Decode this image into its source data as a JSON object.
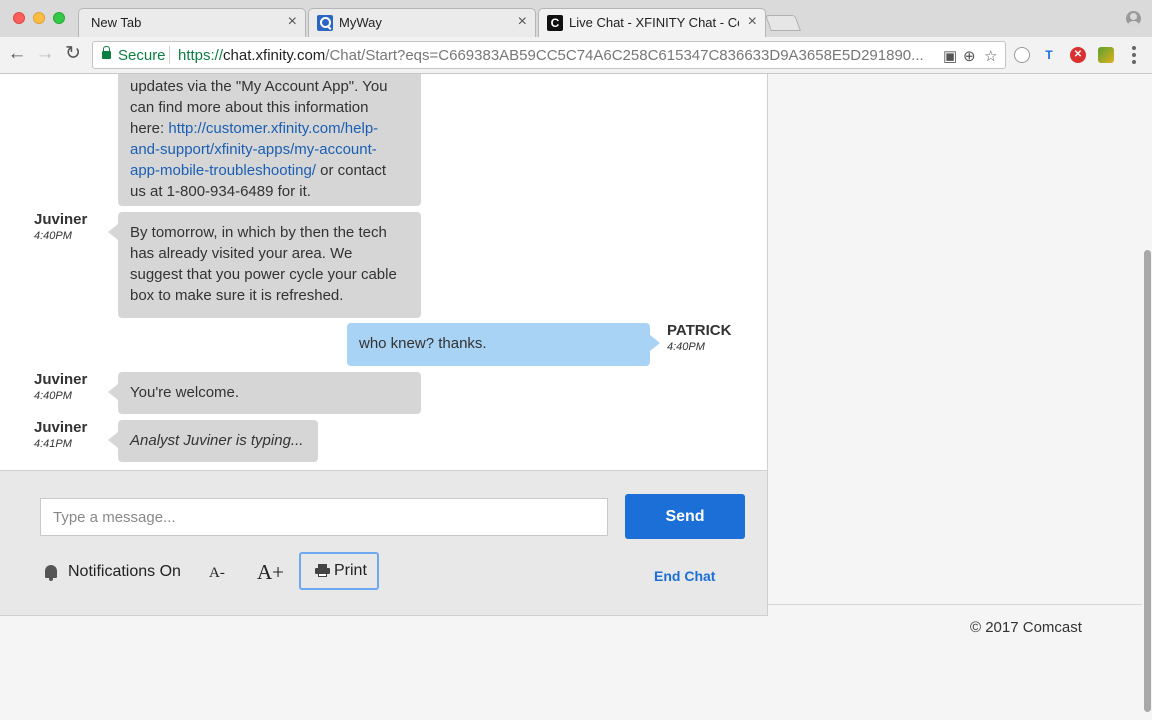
{
  "browser": {
    "tabs": [
      {
        "title": "New Tab",
        "close": "×"
      },
      {
        "title": "MyWay",
        "close": "×"
      },
      {
        "title": "Live Chat - XFINITY Chat - Co",
        "close": "×",
        "favicon_letter": "C"
      }
    ],
    "address": {
      "secure_label": "Secure",
      "url_protocol": "https://",
      "url_host": "chat.xfinity.com",
      "url_path": "/Chat/Start?eqs=C669383AB59CC5C74A6C258C615347C836633D9A3658E5D291890..."
    },
    "nav": {
      "back": "←",
      "forward": "→",
      "reload": "↻"
    },
    "omnibox_icons": {
      "page_icon": "▣",
      "zoom_icon": "⊕",
      "star": "☆"
    },
    "extensions": {
      "ext_t": "T",
      "ext_block": "✕"
    }
  },
  "chat": {
    "messages": [
      {
        "sender": "",
        "time": "",
        "lines": [
          "updates via the \"My Account App\". You",
          "can find more about this information",
          "here: "
        ],
        "link_lines": [
          "http://customer.xfinity.com/help-",
          "and-support/xfinity-apps/my-account-",
          "app-mobile-troubleshooting/"
        ],
        "tail_lines": [
          " or contact",
          "us at 1-800-934-6489 for it."
        ]
      },
      {
        "sender": "Juviner",
        "time": "4:40PM",
        "text": "By tomorrow, in which by then the tech has already visited your area. We suggest that you power cycle your cable box to make sure it is refreshed."
      },
      {
        "sender": "PATRICK",
        "time": "4:40PM",
        "text": "who knew? thanks."
      },
      {
        "sender": "Juviner",
        "time": "4:40PM",
        "text": "You're welcome."
      },
      {
        "sender": "Juviner",
        "time": "4:41PM",
        "text": "Analyst Juviner is typing..."
      }
    ]
  },
  "composer": {
    "placeholder": "Type a message...",
    "send_label": "Send",
    "notifications_label": "Notifications On",
    "font_decrease": "A-",
    "font_increase": "A+",
    "print_label": "Print",
    "end_chat_label": "End Chat"
  },
  "footer": {
    "copyright": "© 2017 Comcast"
  },
  "colors": {
    "send_button": "#1b6fd6",
    "agent_bubble": "#d6d6d6",
    "user_bubble": "#a8d3f5",
    "link": "#1a5fb4"
  }
}
